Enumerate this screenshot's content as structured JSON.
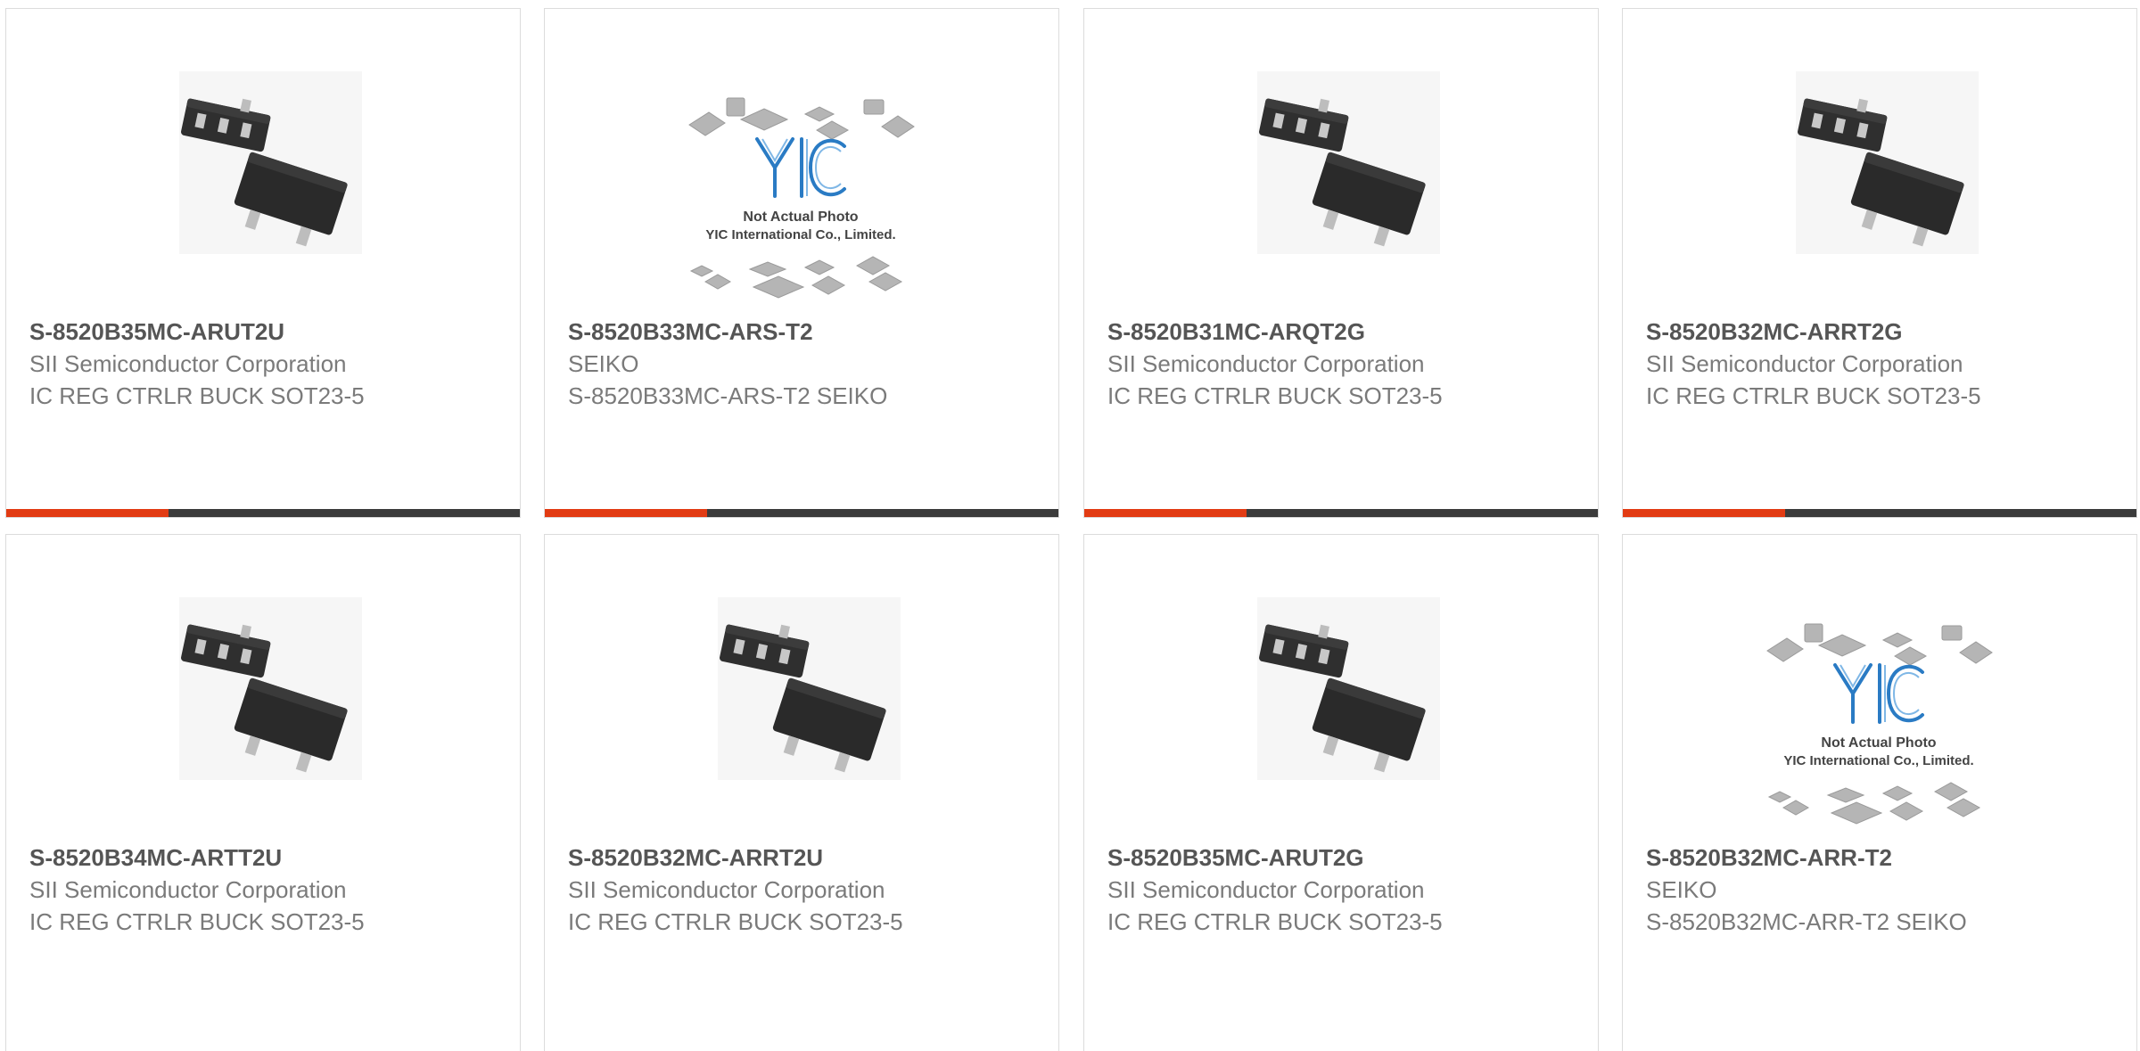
{
  "colors": {
    "accent": "#e23b13",
    "bar_dark": "#3b3b3b",
    "text_title": "#555555",
    "text_body": "#7a7a7a",
    "logo_blue": "#2a7bc4"
  },
  "placeholder": {
    "line1": "Not Actual Photo",
    "line2": "YIC International Co., Limited.",
    "logo_text": "YIC"
  },
  "products": [
    {
      "part_number": "S-8520B35MC-ARUT2U",
      "manufacturer": "SII Semiconductor Corporation",
      "description": "IC REG CTRLR BUCK SOT23-5",
      "image": "sot23-5-package-icon"
    },
    {
      "part_number": "S-8520B33MC-ARS-T2",
      "manufacturer": "SEIKO",
      "description": "S-8520B33MC-ARS-T2 SEIKO",
      "image": "not-actual-photo-placeholder"
    },
    {
      "part_number": "S-8520B31MC-ARQT2G",
      "manufacturer": "SII Semiconductor Corporation",
      "description": "IC REG CTRLR BUCK SOT23-5",
      "image": "sot23-5-package-icon"
    },
    {
      "part_number": "S-8520B32MC-ARRT2G",
      "manufacturer": "SII Semiconductor Corporation",
      "description": "IC REG CTRLR BUCK SOT23-5",
      "image": "sot23-5-package-icon"
    },
    {
      "part_number": "S-8520B34MC-ARTT2U",
      "manufacturer": "SII Semiconductor Corporation",
      "description": "IC REG CTRLR BUCK SOT23-5",
      "image": "sot23-5-package-icon"
    },
    {
      "part_number": "S-8520B32MC-ARRT2U",
      "manufacturer": "SII Semiconductor Corporation",
      "description": "IC REG CTRLR BUCK SOT23-5",
      "image": "sot23-5-package-icon"
    },
    {
      "part_number": "S-8520B35MC-ARUT2G",
      "manufacturer": "SII Semiconductor Corporation",
      "description": "IC REG CTRLR BUCK SOT23-5",
      "image": "sot23-5-package-icon"
    },
    {
      "part_number": "S-8520B32MC-ARR-T2",
      "manufacturer": "SEIKO",
      "description": "S-8520B32MC-ARR-T2 SEIKO",
      "image": "not-actual-photo-placeholder"
    }
  ]
}
